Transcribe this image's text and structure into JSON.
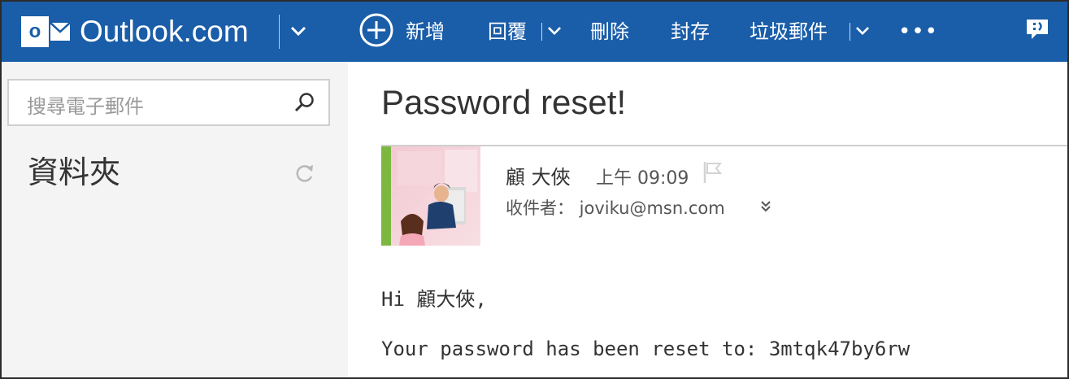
{
  "app": {
    "brand": "Outlook.com",
    "accent_color": "#1a5da8",
    "logo_letter": "o"
  },
  "toolbar": {
    "new_label": "新增",
    "reply_label": "回覆",
    "delete_label": "刪除",
    "archive_label": "封存",
    "junk_label": "垃圾郵件",
    "more_label": "•••"
  },
  "sidebar": {
    "search_placeholder": "搜尋電子郵件",
    "folders_title": "資料夾"
  },
  "message": {
    "subject": "Password reset!",
    "sender_name": "顧 大俠",
    "sent_time": "上午 09:09",
    "to_line": "收件者： joviku@msn.com",
    "greeting": "Hi 顧大俠,",
    "body": "Your password has been reset to: 3mtqk47by6rw",
    "sender_accent_color": "#7cb740"
  },
  "icons": {
    "logo": "outlook-logo-icon",
    "brand_menu": "chevron-down-icon",
    "new": "plus-circle-icon",
    "reply_menu": "chevron-down-icon",
    "junk_menu": "chevron-down-icon",
    "chat": "chat-icon",
    "search": "search-icon",
    "refresh": "refresh-icon",
    "flag": "flag-icon",
    "expand": "double-chevron-down-icon"
  }
}
